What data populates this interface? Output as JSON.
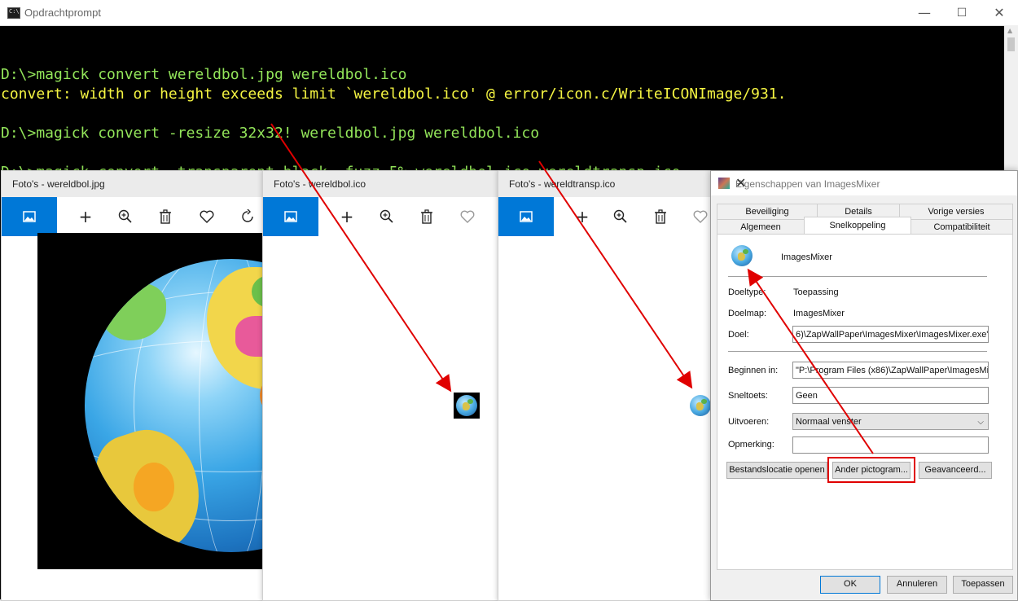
{
  "cmd": {
    "title": "Opdrachtprompt",
    "lines": [
      "D:\\>magick convert wereldbol.jpg wereldbol.ico",
      "convert: width or height exceeds limit `wereldbol.ico' @ error/icon.c/WriteICONImage/931.",
      "",
      "D:\\>magick convert -resize 32x32! wereldbol.jpg wereldbol.ico",
      "",
      "D:\\>magick convert -transparent black -fuzz 5% wereldbol.ico wereldtransp.ico"
    ],
    "window_controls": {
      "minimize": "—",
      "maximize": "☐",
      "close": "✕"
    }
  },
  "photos": [
    {
      "title": "Foto's - wereldbol.jpg"
    },
    {
      "title": "Foto's - wereldbol.ico"
    },
    {
      "title": "Foto's - wereldtransp.ico"
    }
  ],
  "props": {
    "title": "Eigenschappen van ImagesMixer",
    "tabs_row1": [
      "Beveiliging",
      "Details",
      "Vorige versies"
    ],
    "tabs_row2": [
      "Algemeen",
      "Snelkoppeling",
      "Compatibiliteit"
    ],
    "active_tab": "Snelkoppeling",
    "app_name": "ImagesMixer",
    "fields": {
      "doeltype_label": "Doeltype:",
      "doeltype_value": "Toepassing",
      "doelmap_label": "Doelmap:",
      "doelmap_value": "ImagesMixer",
      "doel_label": "Doel:",
      "doel_value": "6)\\ZapWallPaper\\ImagesMixer\\ImagesMixer.exe\"",
      "beginnen_label": "Beginnen in:",
      "beginnen_value": "\"P:\\Program Files (x86)\\ZapWallPaper\\ImagesMi",
      "sneltoets_label": "Sneltoets:",
      "sneltoets_value": "Geen",
      "uitvoeren_label": "Uitvoeren:",
      "uitvoeren_value": "Normaal venster",
      "opmerking_label": "Opmerking:",
      "opmerking_value": ""
    },
    "buttons": {
      "open_location": "Bestandslocatie openen",
      "change_icon": "Ander pictogram...",
      "advanced": "Geavanceerd...",
      "ok": "OK",
      "cancel": "Annuleren",
      "apply": "Toepassen"
    }
  },
  "colors": {
    "accent": "#0078d7",
    "highlight": "#e00000",
    "cmd_text": "#f5f542",
    "cmd_prompt": "#93e55a"
  }
}
